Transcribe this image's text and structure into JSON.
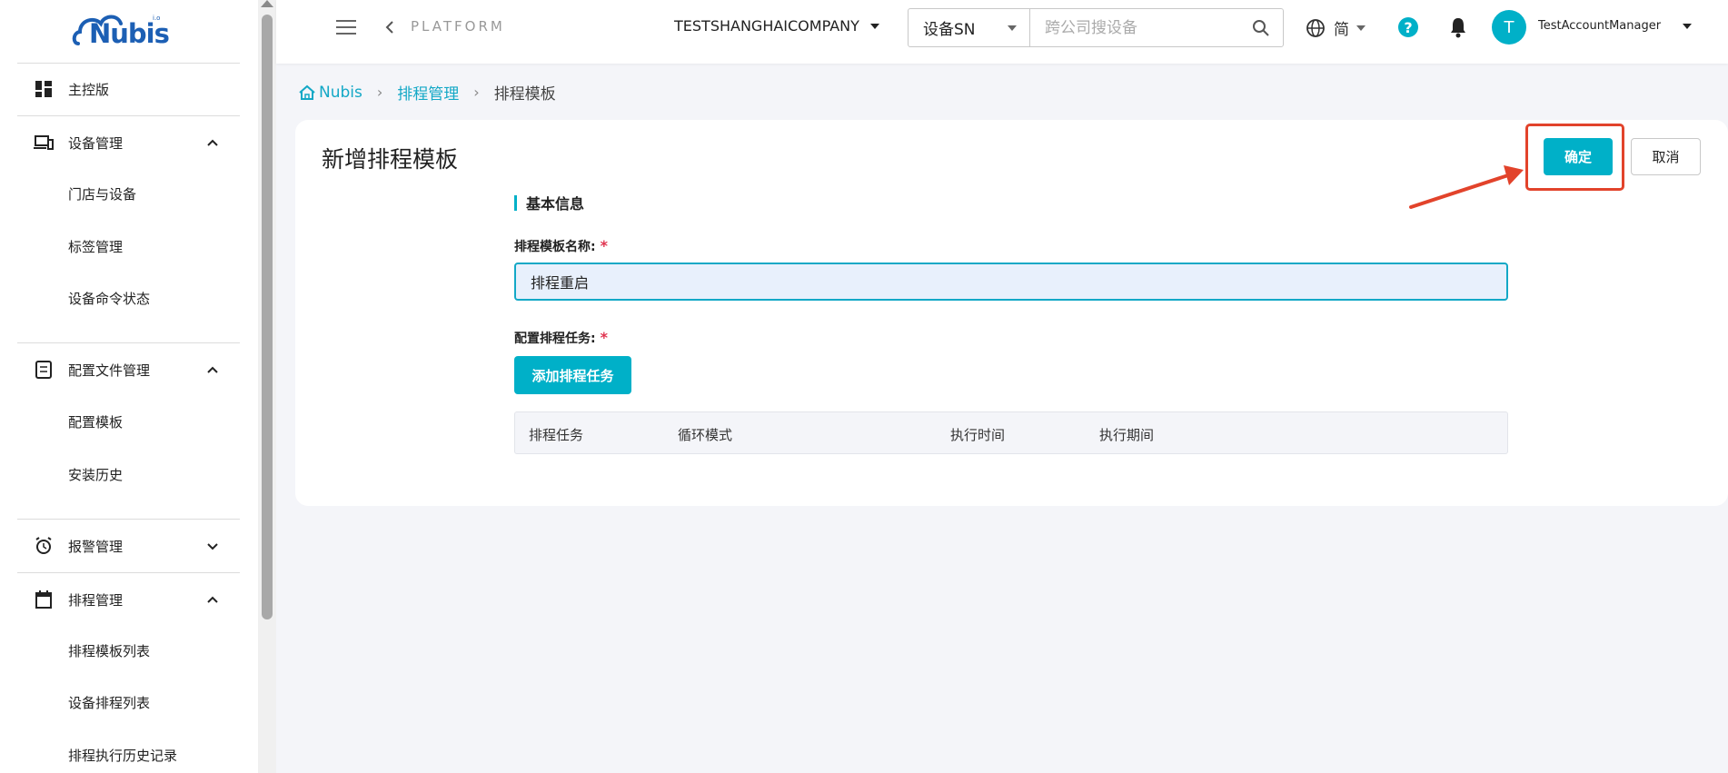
{
  "sidebar": {
    "logo_text": "Nubis",
    "logo_sup": "i.o",
    "items": [
      {
        "label": "主控版"
      },
      {
        "label": "设备管理"
      },
      {
        "label": "门店与设备"
      },
      {
        "label": "标签管理"
      },
      {
        "label": "设备命令状态"
      },
      {
        "label": "配置文件管理"
      },
      {
        "label": "配置模板"
      },
      {
        "label": "安装历史"
      },
      {
        "label": "报警管理"
      },
      {
        "label": "排程管理"
      },
      {
        "label": "排程模板列表"
      },
      {
        "label": "设备排程列表"
      },
      {
        "label": "排程执行历史记录"
      }
    ]
  },
  "header": {
    "platform": "PLATFORM",
    "company": "TESTSHANGHAICOMPANY",
    "search_type": "设备SN",
    "search_placeholder": "跨公司搜设备",
    "language": "简",
    "help": "?",
    "avatar_initial": "T",
    "username": "TestAccountManager"
  },
  "breadcrumb": {
    "home": "Nubis",
    "section": "排程管理",
    "current": "排程模板"
  },
  "form": {
    "title": "新增排程模板",
    "confirm_label": "确定",
    "cancel_label": "取消",
    "section_title": "基本信息",
    "name_label": "排程模板名称:",
    "name_value": "排程重启",
    "tasks_label": "配置排程任务:",
    "required_mark": "*",
    "add_task_label": "添加排程任务",
    "table_headers": [
      "排程任务",
      "循环模式",
      "执行时间",
      "执行期间"
    ]
  },
  "colors": {
    "accent": "#00b0c8",
    "link": "#13a8c6",
    "highlight": "#e2432b",
    "required": "#e0334f"
  }
}
